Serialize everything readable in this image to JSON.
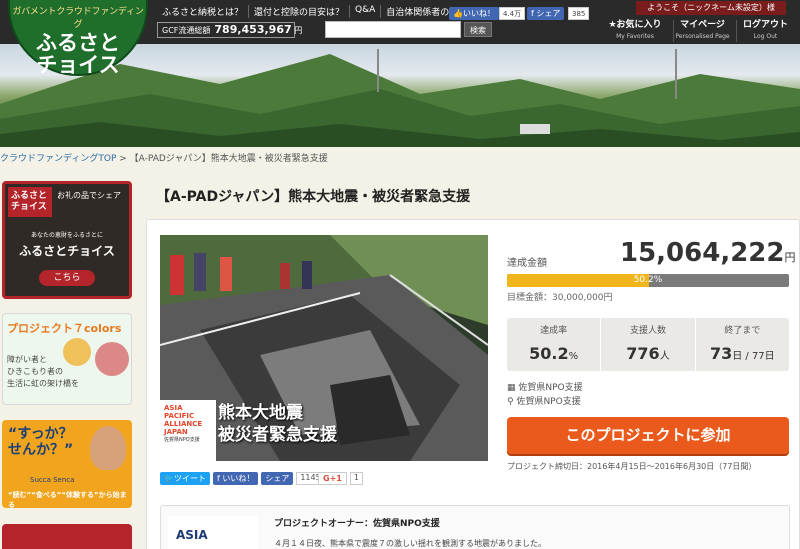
{
  "header": {
    "logo_sub": "ガバメントクラウドファンディング",
    "logo_main": "ふるさと\nチョイス",
    "nav": [
      "ふるさと納税とは？",
      "還付と控除の目安は？",
      "Q&A",
      "自治体関係者の方へ"
    ],
    "gcf_label": "GCF流通総額",
    "gcf_value": "789,453,967",
    "gcf_unit": "円",
    "search_placeholder": "",
    "search_button": "検索",
    "like_label": "いいね！",
    "like_count": "4.4万",
    "share_label": "シェア",
    "share_count": "385",
    "welcome": "ようこそ（ニックネーム未設定）様",
    "favorites": "★お気に入り",
    "favorites_sub": "My Favorites",
    "mypage": "マイページ",
    "mypage_sub": "Personalised Page",
    "logout": "ログアウト",
    "logout_sub": "Log Out"
  },
  "breadcrumb": {
    "home": "クラウドファンディングTOP",
    "sep": " > ",
    "current": "【A-PADジャパン】熊本大地震・被災者緊急支援"
  },
  "sidebar": {
    "ad1": {
      "logo": "ふるさと\nチョイス",
      "tag": "お礼の品でシェア",
      "small": "あなたの恵財をふるさとに",
      "title": "ふるさとチョイス",
      "button": "こちら"
    },
    "ad2": {
      "title": "プロジェクト７colors",
      "text": "障がい者と\nひきこもり者の\n生活に虹の架け橋を"
    },
    "ad3": {
      "title": "“すっか？\nせんか？”",
      "brand": "Succa Senca",
      "text": "“読む”“食べる”“体験する”から始まる"
    },
    "ad4": {}
  },
  "project": {
    "title": "【A-PADジャパン】熊本大地震・被災者緊急支援",
    "image_org": "ASIA\nPACIFIC\nALLIANCE\nJAPAN",
    "image_org_small": "佐賀県NPO支援",
    "image_caption": "熊本大地震\n被災者緊急支援",
    "tweet": "ツイート",
    "fb_like": "いいね！",
    "fb_share": "シェア",
    "share_count": "1145",
    "gplus": "G+1",
    "gplus_count": "1"
  },
  "funding": {
    "raised_label": "達成金額",
    "raised": "15,064,222",
    "unit": "円",
    "progress": 0.502,
    "progress_label": "50.2%",
    "goal": "目標金額：30,000,000円",
    "stats": [
      {
        "label": "達成率",
        "value": "50.2",
        "unit": "%"
      },
      {
        "label": "支援人数",
        "value": "776",
        "unit": "人"
      },
      {
        "label": "終了まで",
        "value": "73",
        "unit": "日 / 77日"
      }
    ],
    "org": "佐賀県NPO支援",
    "location": "佐賀県NPO支援",
    "join": "このプロジェクトに参加",
    "period": "プロジェクト締切日：2016年4月15日～2016年6月30日（77日間）"
  },
  "owner": {
    "logo": "ASIA",
    "title": "プロジェクトオーナー：佐賀県NPO支援",
    "desc": "４月１４日夜、熊本県で震度７の激しい揺れを観測する地震がありました。"
  },
  "colors": {
    "brand_green": "#1f6e2c",
    "accent_orange": "#ea5a1c",
    "progress_yellow": "#f0b51b"
  }
}
